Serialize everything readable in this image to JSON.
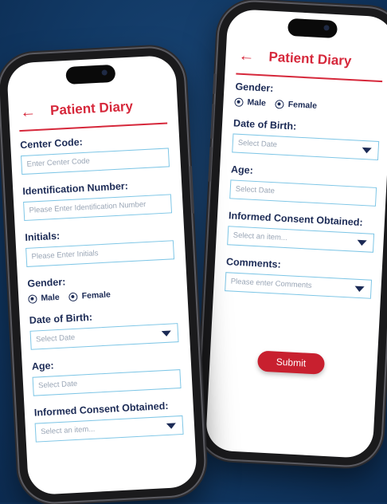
{
  "left_phone": {
    "back_icon": "arrow-left-icon",
    "title": "Patient Diary",
    "center_code": {
      "label": "Center Code:",
      "placeholder": "Enter Center Code"
    },
    "identification": {
      "label": "Identification Number:",
      "placeholder": "Please Enter Identification Number"
    },
    "initials": {
      "label": "Initials:",
      "placeholder": "Please Enter Initials"
    },
    "gender": {
      "label": "Gender:",
      "male": "Male",
      "female": "Female"
    },
    "dob": {
      "label": "Date of Birth:",
      "placeholder": "Select Date"
    },
    "age": {
      "label": "Age:",
      "placeholder": "Select Date"
    },
    "consent": {
      "label": "Informed Consent Obtained:",
      "placeholder": "Select an item..."
    }
  },
  "right_phone": {
    "back_icon": "arrow-left-icon",
    "title": "Patient Diary",
    "gender": {
      "label": "Gender:",
      "male": "Male",
      "female": "Female"
    },
    "dob": {
      "label": "Date of Birth:",
      "placeholder": "Select Date"
    },
    "age": {
      "label": "Age:",
      "placeholder": "Select Date"
    },
    "consent": {
      "label": "Informed Consent Obtained:",
      "placeholder": "Select an item..."
    },
    "comments": {
      "label": "Comments:",
      "placeholder": "Please enter Comments"
    },
    "submit_label": "Submit"
  },
  "colors": {
    "accent": "#d6283b",
    "label": "#1b2a55",
    "field_border": "#7ec6e6",
    "background": "#123a66"
  }
}
